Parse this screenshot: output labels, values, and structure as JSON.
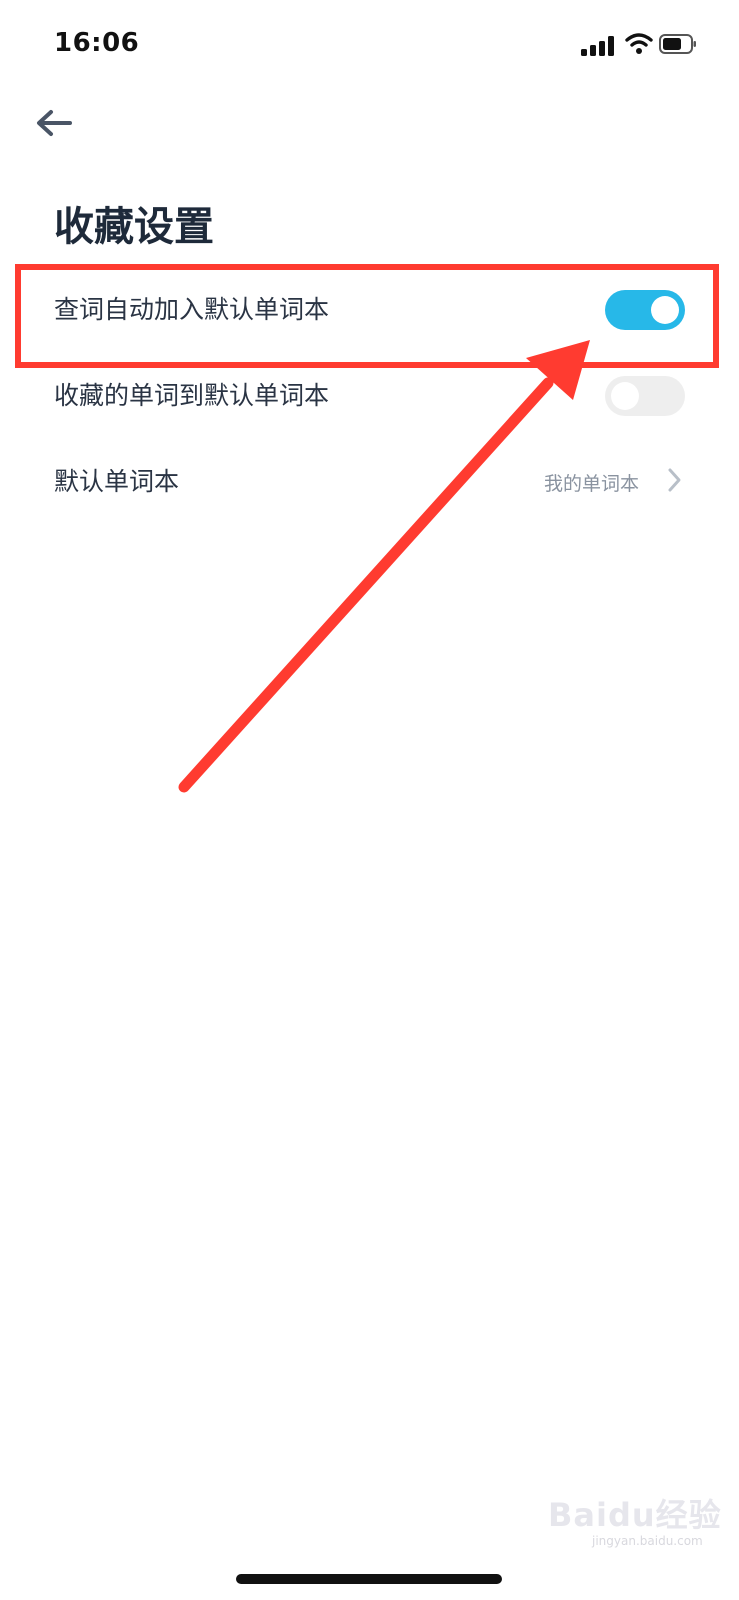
{
  "status_bar": {
    "time": "16:06"
  },
  "header": {
    "title": "收藏设置"
  },
  "settings": [
    {
      "label": "查词自动加入默认单词本",
      "type": "toggle",
      "state": "on"
    },
    {
      "label": "收藏的单词到默认单词本",
      "type": "toggle",
      "state": "off"
    },
    {
      "label": "默认单词本",
      "type": "link",
      "value": "我的单词本"
    }
  ],
  "watermark": {
    "brand": "Baidu经验",
    "site": "jingyan.baidu.com"
  },
  "colors": {
    "toggle_on": "#27b8e8",
    "toggle_off": "#eeeeee",
    "annotation": "#ff3b30",
    "title": "#1e2a3a"
  },
  "icons": {
    "back": "arrow-left-icon",
    "chevron": "chevron-right-icon",
    "signal": "cellular-signal-icon",
    "wifi": "wifi-icon",
    "battery": "battery-icon"
  }
}
